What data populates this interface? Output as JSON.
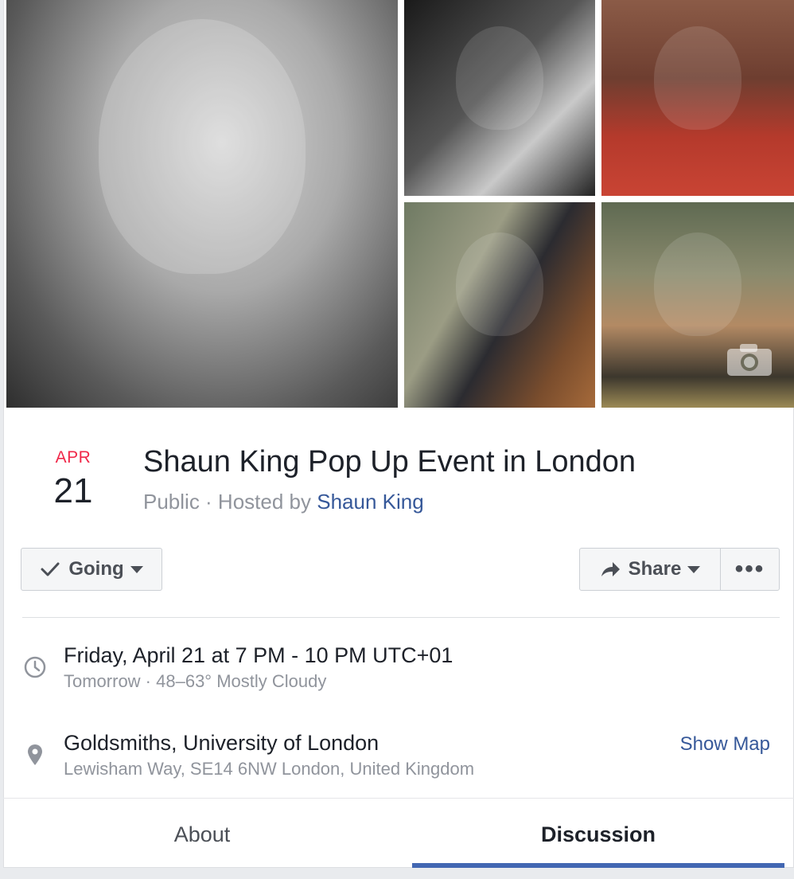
{
  "event": {
    "month": "APR",
    "day": "21",
    "title": "Shaun King Pop Up Event in London",
    "privacy": "Public",
    "hosted_by_prefix": " · Hosted by ",
    "host": "Shaun King"
  },
  "actions": {
    "going_label": "Going",
    "share_label": "Share",
    "more_label": "•••"
  },
  "details": {
    "datetime": "Friday, April 21 at 7 PM - 10 PM UTC+01",
    "weather": "Tomorrow · 48–63° Mostly Cloudy",
    "venue": "Goldsmiths, University of London",
    "address": "Lewisham Way, SE14 6NW London, United Kingdom",
    "show_map": "Show Map"
  },
  "tabs": [
    {
      "label": "About",
      "active": false
    },
    {
      "label": "Discussion",
      "active": true
    }
  ],
  "icons": {
    "check": "check-icon",
    "share": "share-arrow-icon",
    "clock": "clock-icon",
    "pin": "location-pin-icon",
    "camera": "camera-icon"
  },
  "colors": {
    "date_month": "#f02849",
    "link": "#365899",
    "tab_active_underline": "#4267b2",
    "muted_text": "#90949c"
  }
}
